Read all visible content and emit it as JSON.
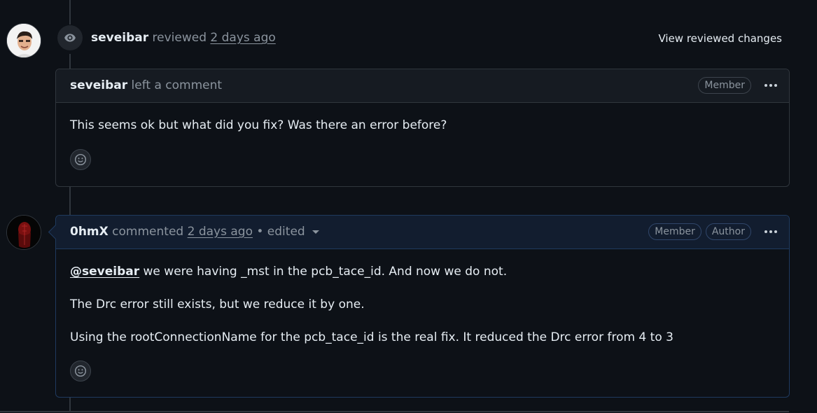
{
  "review_event": {
    "user": "seveibar",
    "action": "reviewed",
    "time": "2 days ago",
    "view_changes_label": "View reviewed changes",
    "icon": "eye-icon"
  },
  "comments": [
    {
      "user": "seveibar",
      "action": "left a comment",
      "badges": [
        "Member"
      ],
      "body": [
        "This seems ok but what did you fix? Was there an error before?"
      ],
      "reaction_icon": "smiley-icon",
      "menu_icon": "kebab-icon"
    },
    {
      "user": "0hmX",
      "action": "commented",
      "time": "2 days ago",
      "edited_label": "• edited",
      "badges": [
        "Member",
        "Author"
      ],
      "mention": "@seveibar",
      "body": [
        " we were having _mst in the pcb_tace_id. And now we do not.",
        "The Drc error still exists, but we reduce it by one.",
        "Using the rootConnectionName for the pcb_tace_id is the real fix. It reduced the Drc error from 4 to 3"
      ],
      "reaction_icon": "smiley-icon",
      "menu_icon": "kebab-icon"
    }
  ],
  "colors": {
    "background": "#0d1117",
    "border": "#30363d",
    "author_border": "#1f3a5f",
    "muted_text": "#8b949e"
  }
}
